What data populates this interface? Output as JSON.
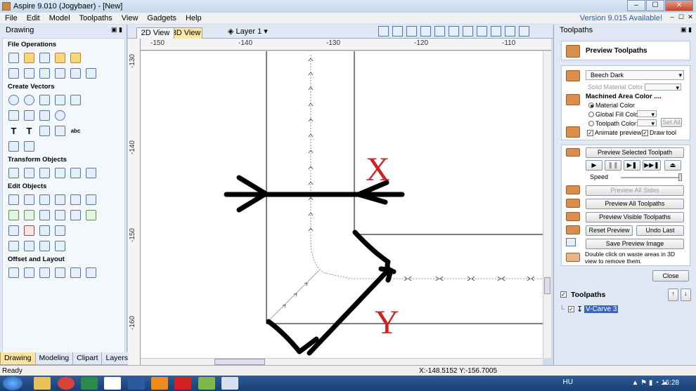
{
  "window": {
    "title": "Aspire 9.010 (Jogybaer) - [New]",
    "controls": [
      "–",
      "☐",
      "✕"
    ]
  },
  "menu": {
    "items": [
      "File",
      "Edit",
      "Model",
      "Toolpaths",
      "View",
      "Gadgets",
      "Help"
    ],
    "version": "Version 9.015 Available!"
  },
  "left_panel": {
    "title": "Drawing",
    "sections": {
      "file_operations": "File Operations",
      "create_vectors": "Create Vectors",
      "transform_objects": "Transform Objects",
      "edit_objects": "Edit Objects",
      "offset_layout": "Offset and Layout"
    },
    "tabs": [
      "Drawing",
      "Modeling",
      "Clipart",
      "Layers"
    ]
  },
  "view": {
    "tab_2d": "2D View",
    "tab_3d": "3D View",
    "layer": "Layer 1 ▾",
    "ruler_h": [
      "-150",
      "-140",
      "-130",
      "-120",
      "-110"
    ],
    "ruler_v": [
      "-130",
      "-140",
      "-150",
      "-160"
    ],
    "annotations": {
      "x": "X",
      "y": "Y"
    }
  },
  "status": {
    "left": "Ready",
    "coords": "X:-148.5152 Y:-156.7005"
  },
  "right_panel": {
    "title": "Toolpaths",
    "preview_title": "Preview Toolpaths",
    "material": "Beech Dark",
    "solid_material_color": "Solid Material Color",
    "machined_area_color": "Machined Area Color ....",
    "material_color": "Material Color",
    "global_fill_color": "Global Fill Color",
    "toolpath_color": "Toolpath Color",
    "set_all": "Set All",
    "animate_preview": "Animate preview",
    "draw_tool": "Draw tool",
    "preview_selected": "Preview Selected Toolpath",
    "speed": "Speed",
    "preview_all_sides": "Preview All Sides",
    "preview_all_toolpaths": "Preview All Toolpaths",
    "preview_visible_toolpaths": "Preview Visible Toolpaths",
    "reset_preview": "Reset Preview",
    "undo_last": "Undo Last",
    "save_preview_image": "Save Preview Image",
    "hint": "Double click on waste areas in 3D view to remove them.",
    "close": "Close",
    "toolpaths_header": "Toolpaths",
    "toolpath_item": "V-Carve 3"
  },
  "taskbar": {
    "lang": "HU",
    "clock": "16:28"
  },
  "colors": {
    "accent": "#1f5ea8",
    "material": "#d88f4e",
    "annotation_red": "#cc2222"
  }
}
